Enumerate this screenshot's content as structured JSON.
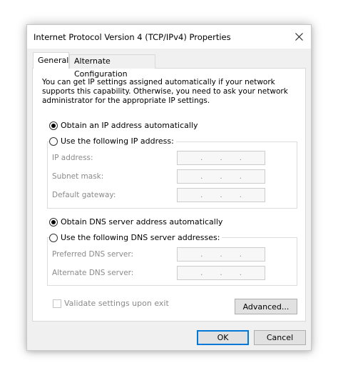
{
  "window": {
    "title": "Internet Protocol Version 4 (TCP/IPv4) Properties",
    "close_icon": "close-icon"
  },
  "tabs": [
    {
      "label": "General",
      "selected": true
    },
    {
      "label": "Alternate Configuration",
      "selected": false
    }
  ],
  "general": {
    "description": "You can get IP settings assigned automatically if your network supports this capability. Otherwise, you need to ask your network administrator for the appropriate IP settings.",
    "ip_auto_label": "Obtain an IP address automatically",
    "ip_auto_selected": true,
    "ip_manual_label": "Use the following IP address:",
    "ip_fields": [
      {
        "label": "IP address:",
        "value": ". . ."
      },
      {
        "label": "Subnet mask:",
        "value": ". . ."
      },
      {
        "label": "Default gateway:",
        "value": ". . ."
      }
    ],
    "dns_auto_label": "Obtain DNS server address automatically",
    "dns_auto_selected": true,
    "dns_manual_label": "Use the following DNS server addresses:",
    "dns_fields": [
      {
        "label": "Preferred DNS server:",
        "value": ". . ."
      },
      {
        "label": "Alternate DNS server:",
        "value": ". . ."
      }
    ],
    "validate_label": "Validate settings upon exit",
    "validate_checked": false,
    "advanced_label": "Advanced..."
  },
  "footer": {
    "ok_label": "OK",
    "cancel_label": "Cancel"
  },
  "colors": {
    "ok_border": "#0078d7",
    "disabled_text": "#8a8a8a"
  }
}
